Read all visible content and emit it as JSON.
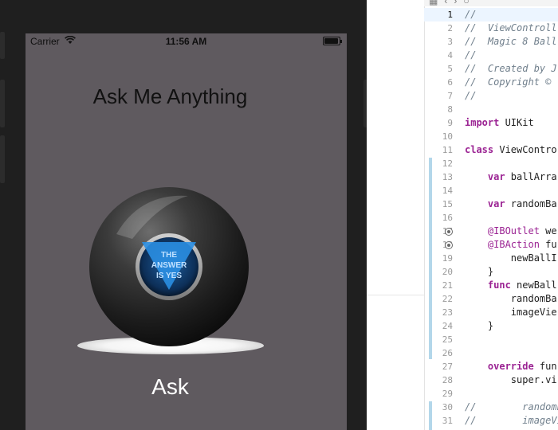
{
  "status_bar": {
    "carrier": "Carrier",
    "time": "11:56 AM"
  },
  "app": {
    "title": "Ask Me Anything",
    "ball_answer": [
      "THE",
      "ANSWER",
      "IS YES"
    ],
    "ask_button": "Ask"
  },
  "editor": {
    "current_line": 1,
    "lines": [
      {
        "n": "1",
        "text": "//",
        "kind": "comment"
      },
      {
        "n": "2",
        "text": "//  ViewControll",
        "kind": "comment"
      },
      {
        "n": "3",
        "text": "//  Magic 8 Ball",
        "kind": "comment"
      },
      {
        "n": "4",
        "text": "//",
        "kind": "comment"
      },
      {
        "n": "5",
        "text": "//  Created by J",
        "kind": "comment"
      },
      {
        "n": "6",
        "text": "//  Copyright ©",
        "kind": "comment"
      },
      {
        "n": "7",
        "text": "//",
        "kind": "comment"
      },
      {
        "n": "8",
        "text": "",
        "kind": "plain"
      },
      {
        "n": "9",
        "kw": "import",
        "text": " UIKit",
        "kind": "kw"
      },
      {
        "n": "10",
        "text": "",
        "kind": "plain"
      },
      {
        "n": "11",
        "kw": "class",
        "text": " ViewContro",
        "kind": "kw"
      },
      {
        "n": "12",
        "text": "",
        "kind": "plain"
      },
      {
        "n": "13",
        "kw": "    var",
        "text": " ballArra",
        "kind": "kw"
      },
      {
        "n": "14",
        "text": "",
        "kind": "plain"
      },
      {
        "n": "15",
        "kw": "    var",
        "text": " randomBa",
        "kind": "kw"
      },
      {
        "n": "16",
        "text": "",
        "kind": "plain"
      },
      {
        "n": "17",
        "kw": "    @IBOutlet",
        "text": " we",
        "kind": "kw"
      },
      {
        "n": "18",
        "kw": "    @IBAction",
        "text": " fu",
        "kind": "kw"
      },
      {
        "n": "19",
        "text": "        newBallI",
        "kind": "plain"
      },
      {
        "n": "20",
        "text": "    }",
        "kind": "plain"
      },
      {
        "n": "21",
        "kw": "    func",
        "text": " newBall",
        "kind": "kw"
      },
      {
        "n": "22",
        "text": "        randomBa",
        "kind": "plain"
      },
      {
        "n": "23",
        "text": "        imageVie",
        "kind": "plain"
      },
      {
        "n": "24",
        "text": "    }",
        "kind": "plain"
      },
      {
        "n": "25",
        "text": "",
        "kind": "plain"
      },
      {
        "n": "26",
        "text": "",
        "kind": "plain"
      },
      {
        "n": "27",
        "kw": "    override",
        "text": " fun",
        "kind": "kw"
      },
      {
        "n": "28",
        "text": "        super.vi",
        "kind": "plain"
      },
      {
        "n": "29",
        "text": "",
        "kind": "plain"
      },
      {
        "n": "30",
        "text": "//        randomE",
        "kind": "comment"
      },
      {
        "n": "31",
        "text": "//        imageVi",
        "kind": "comment"
      }
    ]
  },
  "colors": {
    "screen_background": "#5f5a5f",
    "comment": "#707f8c",
    "keyword": "#9b2393",
    "ball_window": "#1b6fbf"
  }
}
